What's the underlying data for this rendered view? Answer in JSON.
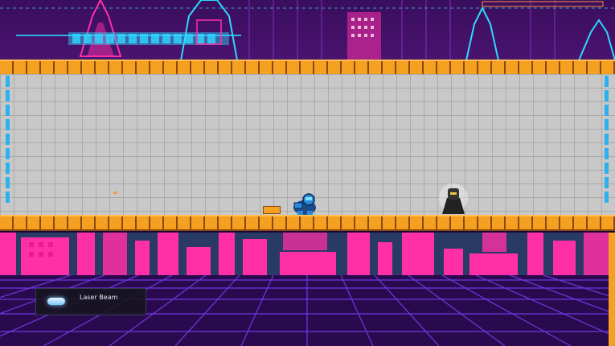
{
  "hud": {
    "weapon_name": "Laser Beam",
    "weapon_icon": "laser-beam-icon"
  },
  "colors": {
    "sky": "#3a0e5e",
    "neon_pink": "#ff2fa8",
    "neon_cyan": "#2fd8ff",
    "brick": "#f5a020",
    "room_floor": "#c8c8c8",
    "grid_line": "#7a3cf0"
  }
}
